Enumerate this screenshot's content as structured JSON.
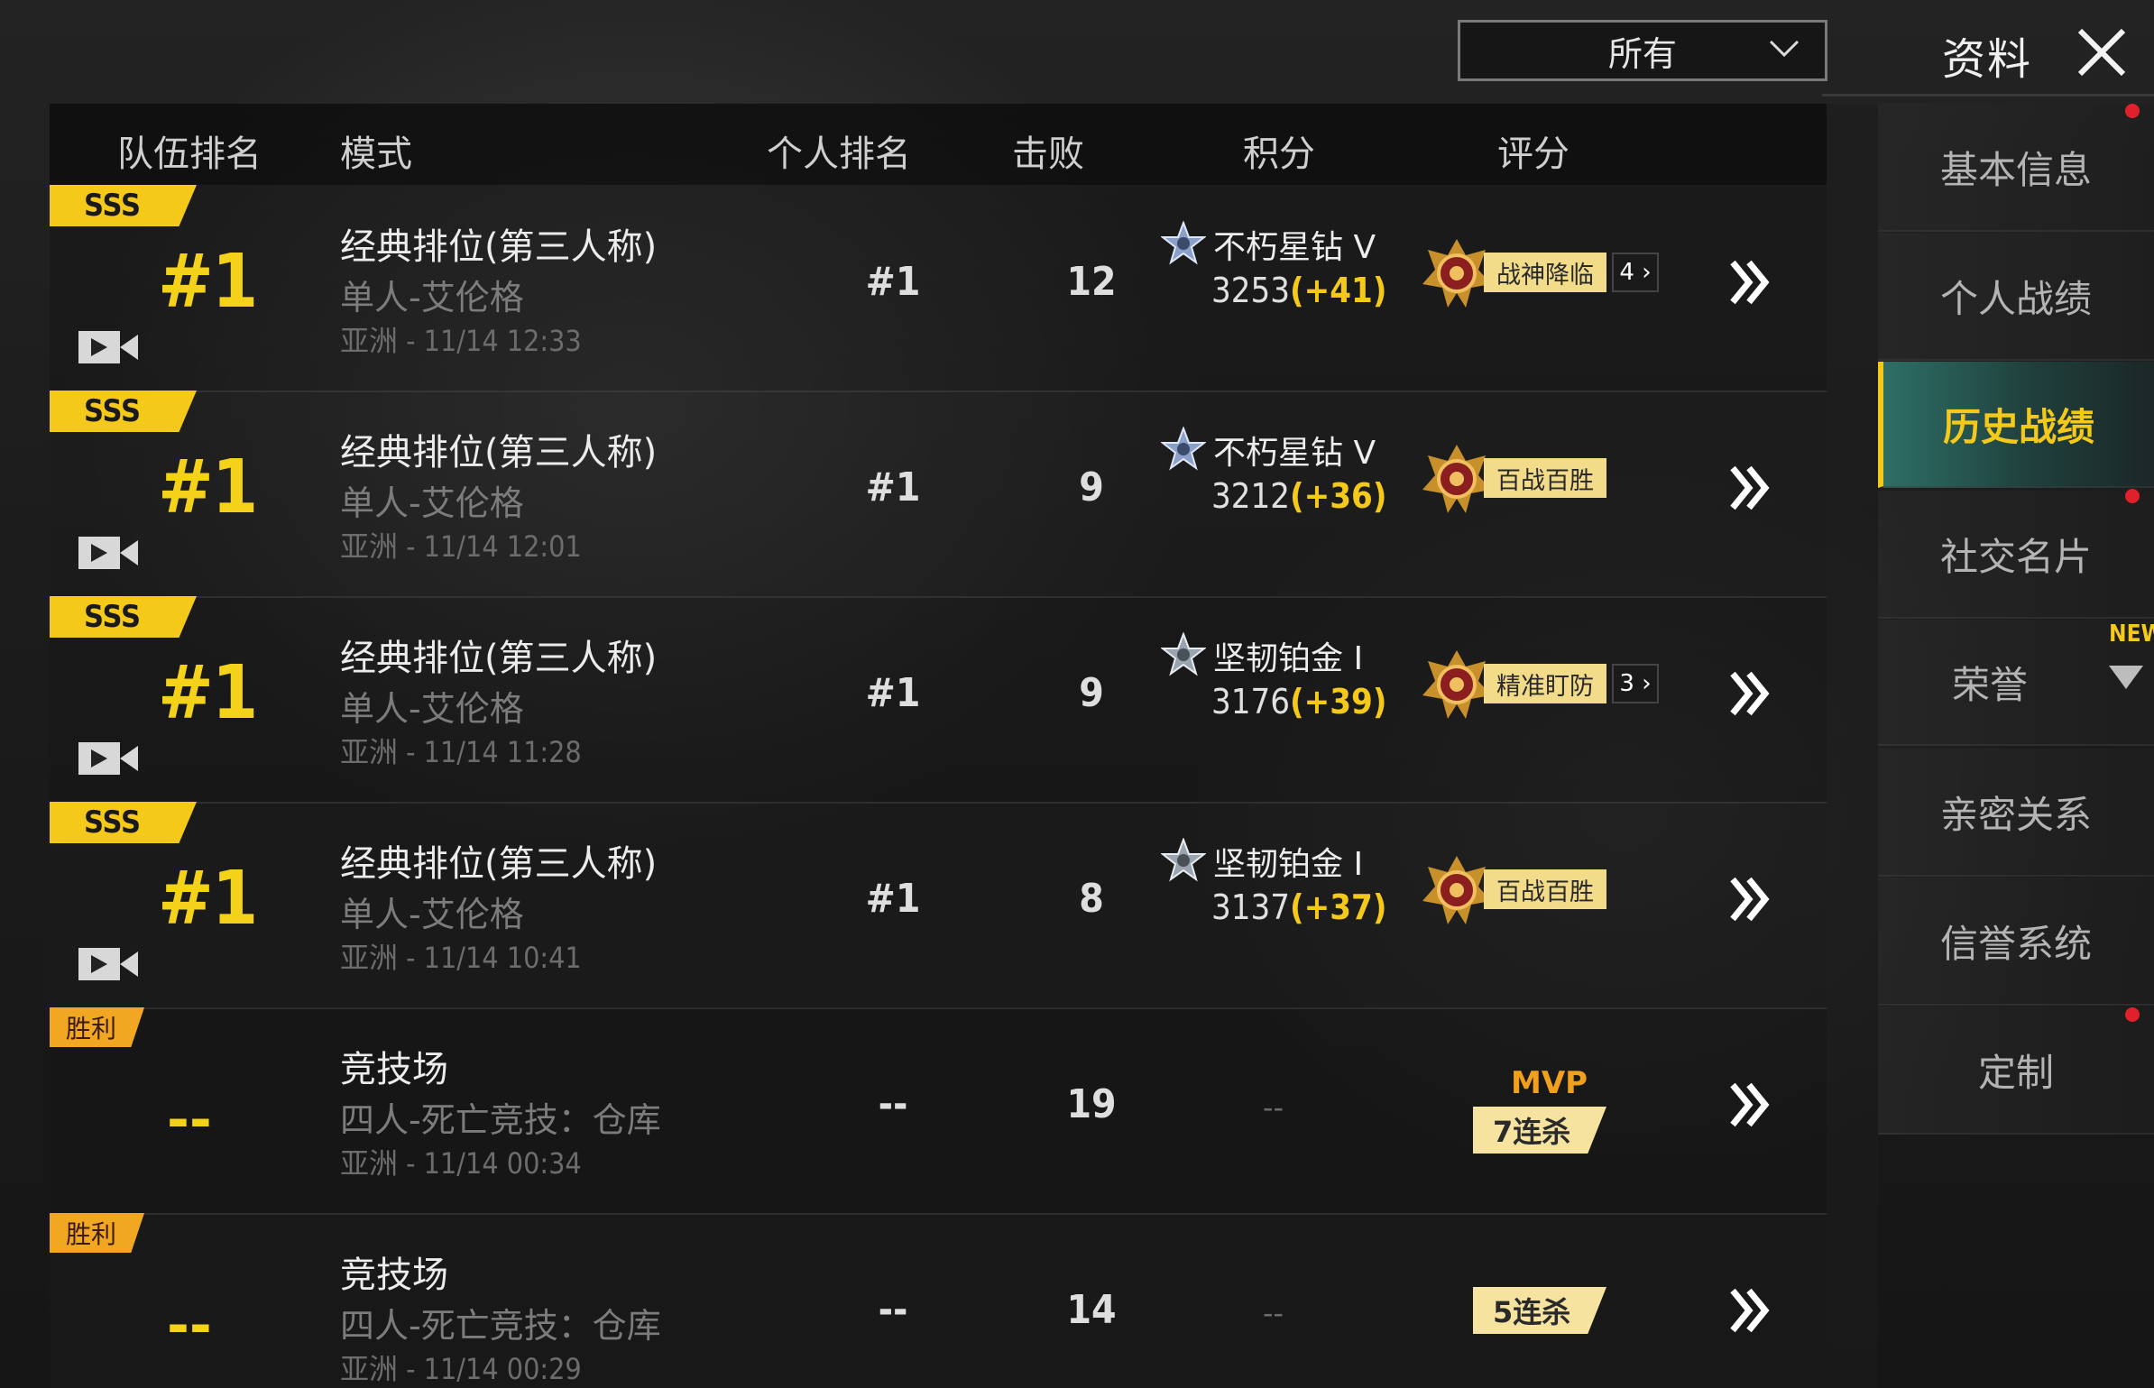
{
  "header": {
    "filter_value": "所有",
    "title": "资料"
  },
  "columns": {
    "team_rank": "队伍排名",
    "mode": "模式",
    "personal_rank": "个人排名",
    "kills": "击败",
    "points": "积分",
    "rating": "评分"
  },
  "matches": [
    {
      "grade": "SSS",
      "team_rank": "#1",
      "mode": "经典排位(第三人称)",
      "sub": "单人-艾伦格",
      "time": "亚洲 - 11/14 12:33",
      "personal_rank": "#1",
      "kills": "12",
      "tier": "不朽星钻 V",
      "points": "3253",
      "delta": "(+41)",
      "rating_tag": "战神降临",
      "rating_more": "4"
    },
    {
      "grade": "SSS",
      "team_rank": "#1",
      "mode": "经典排位(第三人称)",
      "sub": "单人-艾伦格",
      "time": "亚洲 - 11/14 12:01",
      "personal_rank": "#1",
      "kills": "9",
      "tier": "不朽星钻 V",
      "points": "3212",
      "delta": "(+36)",
      "rating_tag": "百战百胜"
    },
    {
      "grade": "SSS",
      "team_rank": "#1",
      "mode": "经典排位(第三人称)",
      "sub": "单人-艾伦格",
      "time": "亚洲 - 11/14 11:28",
      "personal_rank": "#1",
      "kills": "9",
      "tier": "坚韧铂金 I",
      "points": "3176",
      "delta": "(+39)",
      "rating_tag": "精准盯防",
      "rating_more": "3"
    },
    {
      "grade": "SSS",
      "team_rank": "#1",
      "mode": "经典排位(第三人称)",
      "sub": "单人-艾伦格",
      "time": "亚洲 - 11/14 10:41",
      "personal_rank": "#1",
      "kills": "8",
      "tier": "坚韧铂金 I",
      "points": "3137",
      "delta": "(+37)",
      "rating_tag": "百战百胜"
    },
    {
      "grade": "胜利",
      "team_rank": "--",
      "mode": "竞技场",
      "sub": "四人-死亡竞技：仓库",
      "time": "亚洲 - 11/14 00:34",
      "personal_rank": "--",
      "kills": "19",
      "points_dash": "--",
      "mvp": "MVP",
      "streak": "7连杀"
    },
    {
      "grade": "胜利",
      "team_rank": "--",
      "mode": "竞技场",
      "sub": "四人-死亡竞技：仓库",
      "time": "亚洲 - 11/14 00:29",
      "personal_rank": "--",
      "kills": "14",
      "points_dash": "--",
      "streak": "5连杀"
    }
  ],
  "sidebar": {
    "items": [
      {
        "label": "基本信息"
      },
      {
        "label": "个人战绩"
      },
      {
        "label": "历史战绩"
      },
      {
        "label": "社交名片"
      },
      {
        "label": "荣誉"
      },
      {
        "label": "亲密关系"
      },
      {
        "label": "信誉系统"
      },
      {
        "label": "定制"
      }
    ],
    "new_label": "NEW"
  },
  "colors": {
    "accent": "#f4c91a",
    "win_badge": "#f1a722",
    "active_tab": "#2e6f66",
    "notify": "#e0202a"
  },
  "icons": [
    "chevron-down-icon",
    "close-icon",
    "video-icon",
    "tier-icon",
    "medal-icon",
    "chevron-right-icon",
    "triangle-down-icon"
  ]
}
